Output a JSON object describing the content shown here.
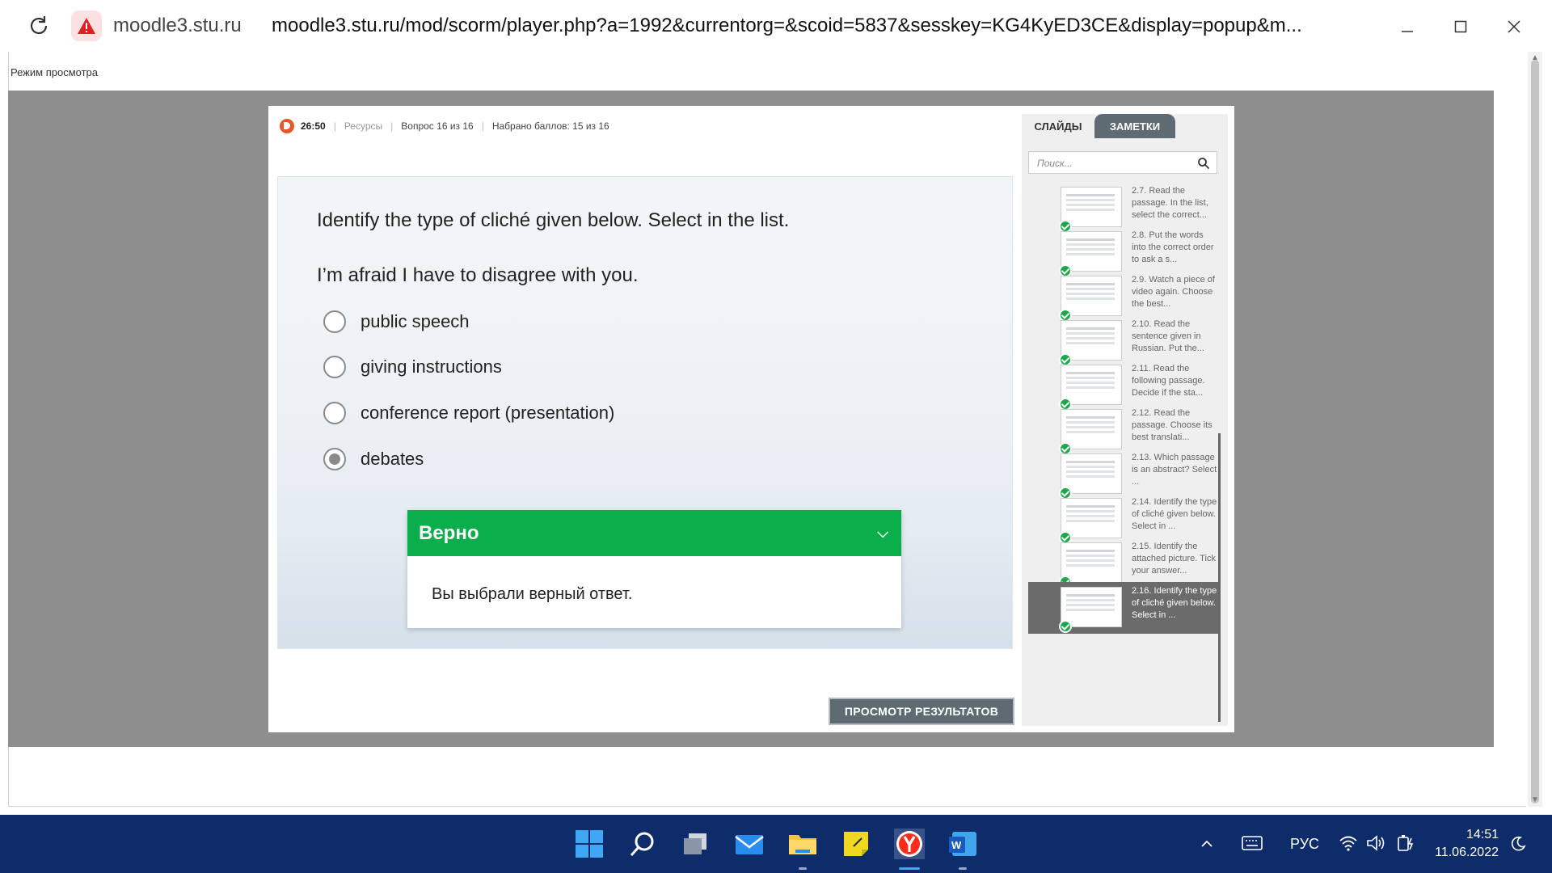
{
  "browser": {
    "domain": "moodle3.stu.ru",
    "url": "moodle3.stu.ru/mod/scorm/player.php?a=1992&currentorg=&scoid=5837&sesskey=KG4KyED3CE&display=popup&m..."
  },
  "page": {
    "mode_label": "Режим просмотра"
  },
  "player": {
    "timer": "26:50",
    "resources": "Ресурсы",
    "question_counter": "Вопрос 16 из 16",
    "score": "Набрано баллов: 15 из 16",
    "question": "Identify the type of cliché given below. Select in the list.",
    "sentence": "I’m afraid I have to disagree with you.",
    "options": [
      {
        "label": "public speech",
        "selected": false
      },
      {
        "label": "giving instructions",
        "selected": false
      },
      {
        "label": "conference report (presentation)",
        "selected": false
      },
      {
        "label": "debates",
        "selected": true
      }
    ],
    "feedback": {
      "title": "Верно",
      "message": "Вы выбрали верный ответ."
    },
    "results_button": "ПРОСМОТР РЕЗУЛЬТАТОВ"
  },
  "sidebar": {
    "tab_slides": "СЛАЙДЫ",
    "tab_notes": "ЗАМЕТКИ",
    "search_placeholder": "Поиск...",
    "slides": [
      {
        "text": "2.7. Read the passage. In the list, select the correct...",
        "completed": true,
        "active": false
      },
      {
        "text": "2.8. Put the words into the correct order to ask a s...",
        "completed": true,
        "active": false
      },
      {
        "text": "2.9. Watch a piece of video again. Choose the best...",
        "completed": true,
        "active": false
      },
      {
        "text": "2.10. Read the sentence given in Russian. Put the...",
        "completed": true,
        "active": false
      },
      {
        "text": "2.11. Read the following passage. Decide if the sta...",
        "completed": true,
        "active": false
      },
      {
        "text": "2.12. Read the passage. Choose its best translati...",
        "completed": true,
        "active": false
      },
      {
        "text": "2.13. Which passage is an abstract? Select ...",
        "completed": true,
        "active": false
      },
      {
        "text": "2.14. Identify the type of cliché given below. Select in ...",
        "completed": true,
        "active": false
      },
      {
        "text": "2.15. Identify the attached picture. Tick your answer...",
        "completed": true,
        "active": false
      },
      {
        "text": "2.16. Identify the type of cliché given below. Select in ...",
        "completed": true,
        "active": true
      }
    ]
  },
  "taskbar": {
    "language": "РУС",
    "time": "14:51",
    "date": "11.06.2022"
  },
  "colors": {
    "feedback_green": "#0aae4b",
    "accent_gray": "#5f6b73",
    "taskbar_bg": "#0e2c6a"
  }
}
